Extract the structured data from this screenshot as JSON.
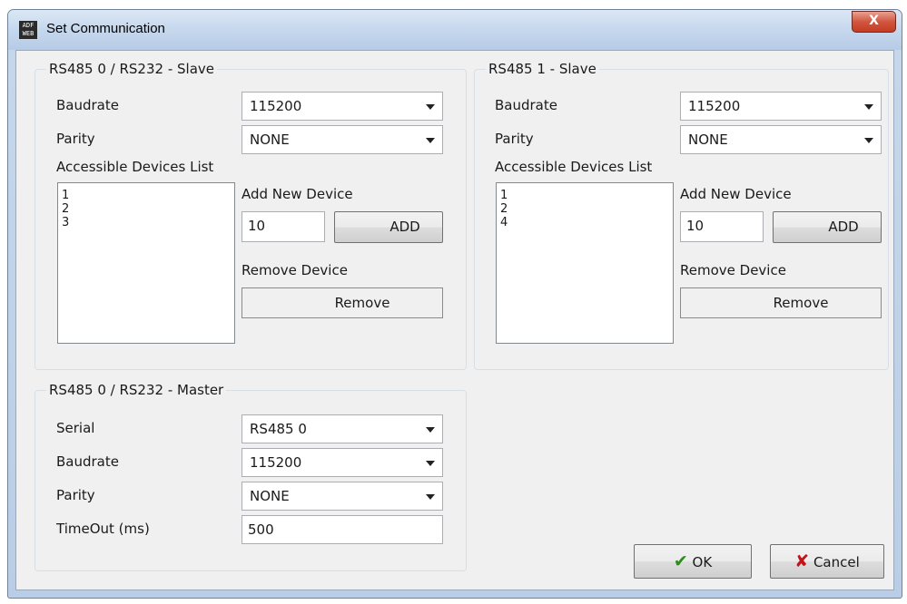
{
  "window": {
    "title": "Set Communication",
    "icon_text": "ADF WEB",
    "close_label": "X"
  },
  "slave0": {
    "legend": "RS485 0 / RS232 - Slave",
    "baudrate_label": "Baudrate",
    "baudrate_value": "115200",
    "parity_label": "Parity",
    "parity_value": "NONE",
    "devices_label": "Accessible Devices List",
    "devices": [
      "1",
      "2",
      "3"
    ],
    "add_label": "Add New Device",
    "new_device_value": "10",
    "add_button": "ADD",
    "remove_label": "Remove Device",
    "remove_button": "Remove"
  },
  "slave1": {
    "legend": "RS485 1 - Slave",
    "baudrate_label": "Baudrate",
    "baudrate_value": "115200",
    "parity_label": "Parity",
    "parity_value": "NONE",
    "devices_label": "Accessible Devices List",
    "devices": [
      "1",
      "2",
      "4"
    ],
    "add_label": "Add New Device",
    "new_device_value": "10",
    "add_button": "ADD",
    "remove_label": "Remove Device",
    "remove_button": "Remove"
  },
  "master": {
    "legend": "RS485 0 / RS232 - Master",
    "serial_label": "Serial",
    "serial_value": "RS485 0",
    "baudrate_label": "Baudrate",
    "baudrate_value": "115200",
    "parity_label": "Parity",
    "parity_value": "NONE",
    "timeout_label": "TimeOut (ms)",
    "timeout_value": "500"
  },
  "buttons": {
    "ok": "OK",
    "cancel": "Cancel"
  },
  "icons": {
    "ok": "check-icon",
    "cancel": "x-icon"
  },
  "colors": {
    "ok_check": "#2e8b1e",
    "cancel_x": "#c2121a"
  }
}
